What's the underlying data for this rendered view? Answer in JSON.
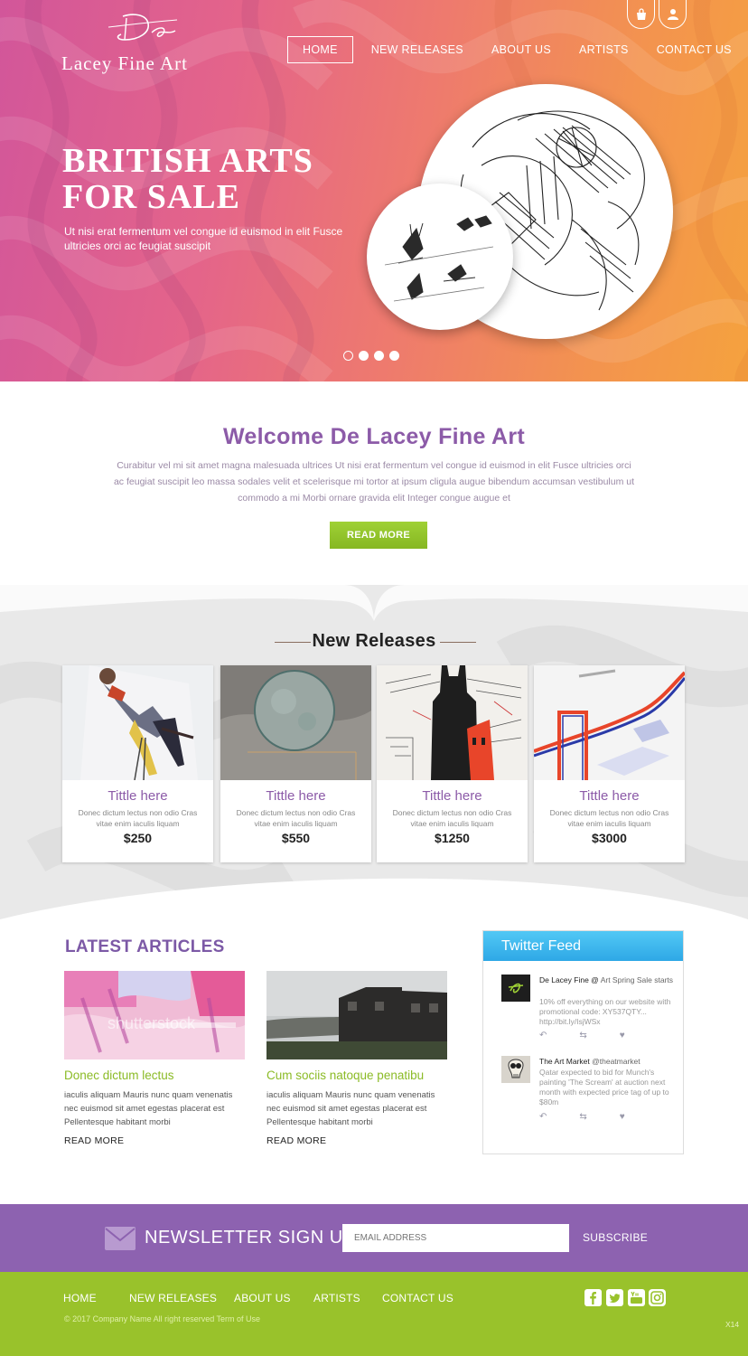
{
  "brand": {
    "script_mark": "De",
    "name": "Lacey Fine Art"
  },
  "header": {
    "icons": [
      "shopping-bag-icon",
      "user-icon"
    ],
    "nav": [
      "HOME",
      "NEW RELEASES",
      "ABOUT US",
      "ARTISTS",
      "CONTACT US"
    ],
    "active_nav": "HOME"
  },
  "hero": {
    "title": "BRITISH ARTS FOR SALE",
    "subtitle": "Ut nisi erat fermentum vel congue id euismod in elit Fusce ultricies orci ac feugiat suscipit",
    "slides_total": 4,
    "active_slide": 1
  },
  "welcome": {
    "title": "Welcome De Lacey Fine Art",
    "text": "Curabitur vel mi sit amet magna malesuada ultrices Ut nisi erat fermentum vel congue id euismod in elit Fusce ultricies orci ac feugiat suscipit leo massa sodales velit et scelerisque mi tortor at ipsum cligula augue bibendum accumsan vestibulum ut commodo a mi Morbi ornare gravida elit Integer congue augue et",
    "button": "READ MORE"
  },
  "releases": {
    "title": "New Releases",
    "items": [
      {
        "title": "Tittle here",
        "desc": "Donec dictum lectus non odio Cras vitae enim iaculis liquam",
        "price": "$250"
      },
      {
        "title": "Tittle here",
        "desc": "Donec dictum lectus non odio Cras vitae enim iaculis liquam",
        "price": "$550"
      },
      {
        "title": "Tittle here",
        "desc": "Donec dictum lectus non odio Cras vitae enim iaculis liquam",
        "price": "$1250"
      },
      {
        "title": "Tittle here",
        "desc": "Donec dictum lectus non odio Cras vitae enim iaculis liquam",
        "price": "$3000"
      }
    ]
  },
  "articles": {
    "title": "LATEST ARTICLES",
    "items": [
      {
        "title": "Donec dictum lectus",
        "text": "iaculis aliquam Mauris nunc quam venenatis nec euismod sit amet egestas placerat est Pellentesque habitant morbi",
        "read_more": "READ MORE",
        "watermark": "shutterstock"
      },
      {
        "title": "Cum sociis natoque penatibu",
        "text": "iaculis aliquam Mauris nunc quam venenatis nec euismod sit amet egestas placerat est Pellentesque habitant morbi",
        "read_more": "READ MORE"
      }
    ]
  },
  "twitter": {
    "title": "Twitter Feed",
    "tweets": [
      {
        "name": "De Lacey Fine @",
        "name_link": "Art Spring Sale starts",
        "text": "10% off everything on our website with promotional code: XY537QTY... http://bit.ly/IsjWSx"
      },
      {
        "name": "The Art Market",
        "name_link": "@theatmarket",
        "text": "Qatar expected to bid for Munch's painting 'The Scream' at auction next month with expected price tag of up to $80m"
      }
    ]
  },
  "newsletter": {
    "title": "NEWSLETTER SIGN UP",
    "placeholder": "EMAIL ADDRESS",
    "button": "SUBSCRIBE"
  },
  "footer": {
    "nav": [
      "HOME",
      "NEW RELEASES",
      "ABOUT US",
      "ARTISTS",
      "CONTACT US"
    ],
    "copyright": "© 2017 Company Name  All right reserved  Term of Use",
    "social": [
      "facebook-icon",
      "twitter-icon",
      "youtube-icon",
      "instagram-icon"
    ],
    "tag": "X14"
  },
  "colors": {
    "accent_purple": "#8c5ba8",
    "accent_green": "#99c22b",
    "twitter_blue": "#3bb6ec",
    "hero_pink": "#d2569a",
    "hero_orange": "#f5a23e"
  }
}
